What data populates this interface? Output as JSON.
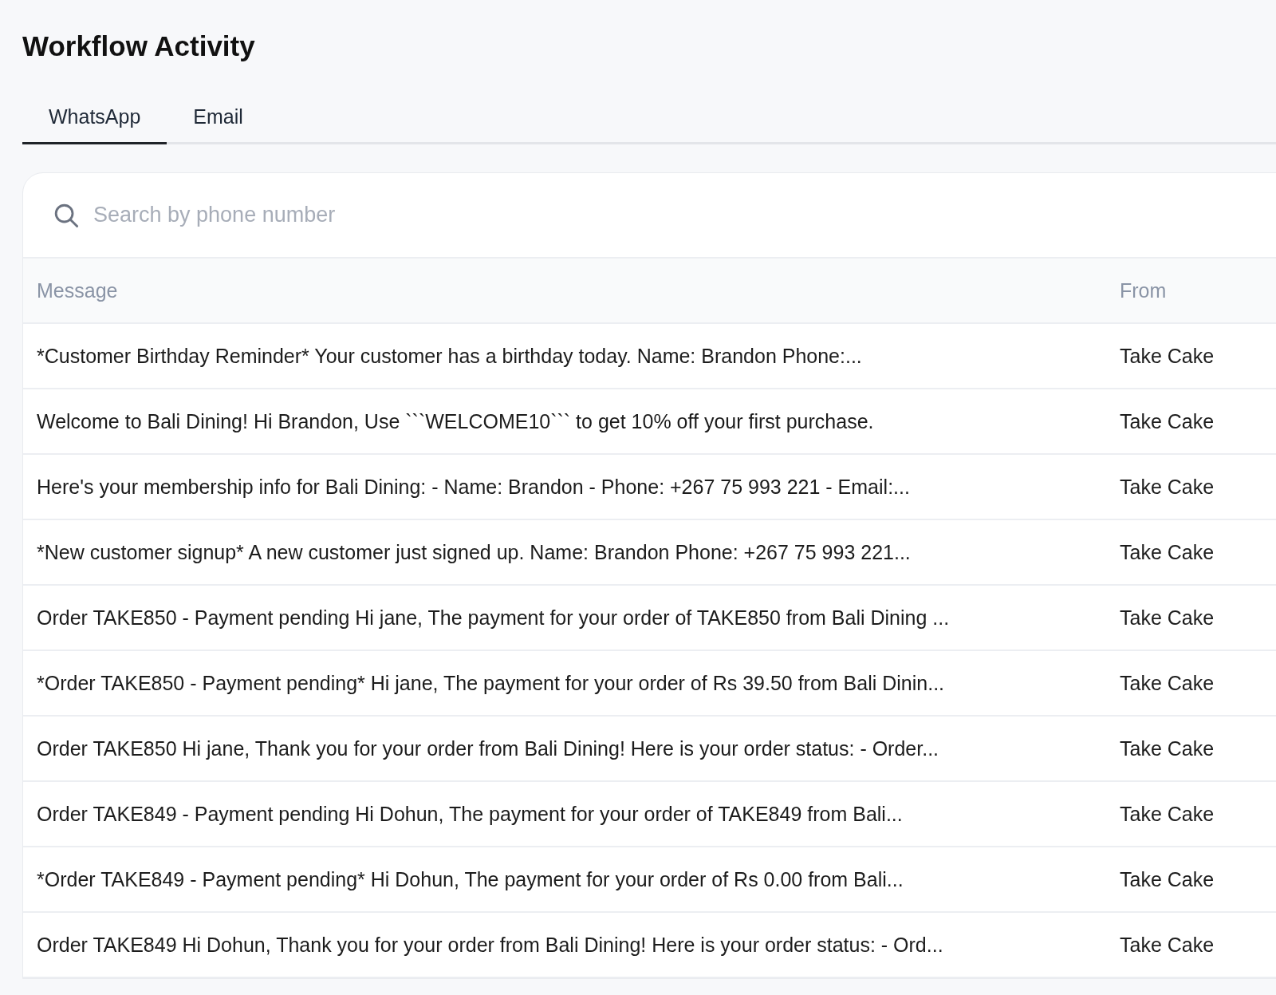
{
  "page": {
    "title": "Workflow Activity"
  },
  "tabs": [
    {
      "label": "WhatsApp",
      "selected": true
    },
    {
      "label": "Email",
      "selected": false
    }
  ],
  "search": {
    "placeholder": "Search by phone number"
  },
  "table": {
    "columns": [
      "Message",
      "From"
    ],
    "rows": [
      {
        "message": "*Customer Birthday Reminder* Your customer has a birthday today. Name: Brandon Phone:...",
        "from": "Take Cake"
      },
      {
        "message": "Welcome to Bali Dining! Hi Brandon, Use ```WELCOME10``` to get 10% off your first purchase.",
        "from": "Take Cake"
      },
      {
        "message": "Here's your membership info for Bali Dining: - Name: Brandon - Phone: +267 75 993 221 - Email:...",
        "from": "Take Cake"
      },
      {
        "message": "*New customer signup* A new customer just signed up. Name: Brandon Phone: +267 75 993 221...",
        "from": "Take Cake"
      },
      {
        "message": "Order TAKE850 - Payment pending Hi jane, The payment for your order of TAKE850 from Bali Dining ...",
        "from": "Take Cake"
      },
      {
        "message": "*Order TAKE850 - Payment pending* Hi jane, The payment for your order of Rs 39.50 from Bali Dinin...",
        "from": "Take Cake"
      },
      {
        "message": "Order TAKE850 Hi jane, Thank you for your order from Bali Dining! Here is your order status: - Order...",
        "from": "Take Cake"
      },
      {
        "message": "Order TAKE849 - Payment pending Hi Dohun, The payment for your order of TAKE849 from Bali...",
        "from": "Take Cake"
      },
      {
        "message": "*Order TAKE849 - Payment pending* Hi Dohun, The payment for your order of Rs 0.00 from Bali...",
        "from": "Take Cake"
      },
      {
        "message": "Order TAKE849 Hi Dohun, Thank you for your order from Bali Dining! Here is your order status: - Ord...",
        "from": "Take Cake"
      }
    ]
  }
}
